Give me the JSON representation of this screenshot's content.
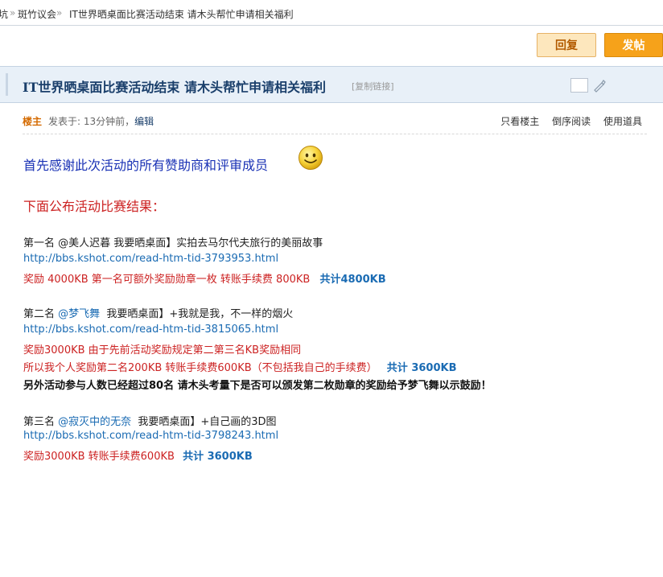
{
  "breadcrumb": {
    "prefix": "坑",
    "sep1": "»",
    "forum": "斑竹议会",
    "sep2": "»",
    "thread": "IT世界晒桌面比赛活动结束 请木头帮忙申请相关福利"
  },
  "toolbar": {
    "reply_label": "回复",
    "post_label": "发帖"
  },
  "thread": {
    "title": "IT世界晒桌面比赛活动结束 请木头帮忙申请相关福利",
    "copy_link": "[复制链接]"
  },
  "post_meta": {
    "floor": "楼主",
    "posted": "发表于: 13分钟前",
    "separator": "，",
    "edit": "编辑",
    "links": [
      "只看楼主",
      "倒序阅读",
      "使用道具"
    ]
  },
  "content": {
    "thanks": "首先感谢此次活动的所有赞助商和评审成员",
    "announce": "下面公布活动比赛结果：",
    "first": {
      "line": "第一名 @美人迟暮 我要晒桌面】实拍去马尔代夫旅行的美丽故事",
      "url": "http://bbs.kshot.com/read-htm-tid-3793953.html",
      "reward": "奖励 4000KB 第一名可额外奖励勋章一枚 转账手续费 800KB",
      "total_label": "共计4800KB"
    },
    "second": {
      "rank": "第二名",
      "nick": "@梦飞舞",
      "title": "我要晒桌面】+我就是我，不一样的烟火",
      "url": "http://bbs.kshot.com/read-htm-tid-3815065.html",
      "reward1": "奖励3000KB 由于先前活动奖励规定第二第三名KB奖励相同",
      "reward2": "所以我个人奖励第二名200KB 转账手续费600KB（不包括我自己的手续费）",
      "total_label": "共计 3600KB",
      "note": "另外活动参与人数已经超过80名 请木头考量下是否可以颁发第二枚勋章的奖励给予梦飞舞以示鼓励！"
    },
    "third": {
      "rank": "第三名",
      "nick": "@寂灭中的无奈",
      "title": "我要晒桌面】+自己画的3D图",
      "url": "http://bbs.kshot.com/read-htm-tid-3798243.html",
      "reward": "奖励3000KB 转账手续费600KB",
      "total_label": "共计 3600KB"
    }
  },
  "icons": [
    "smiley-icon",
    "pen-icon",
    "checkbox-icon"
  ],
  "colors": {
    "accent": "#f6a21a",
    "title": "#1a3f6b",
    "link": "#1a6bb3",
    "reward": "#cc2222",
    "thanks": "#1a32b5"
  }
}
